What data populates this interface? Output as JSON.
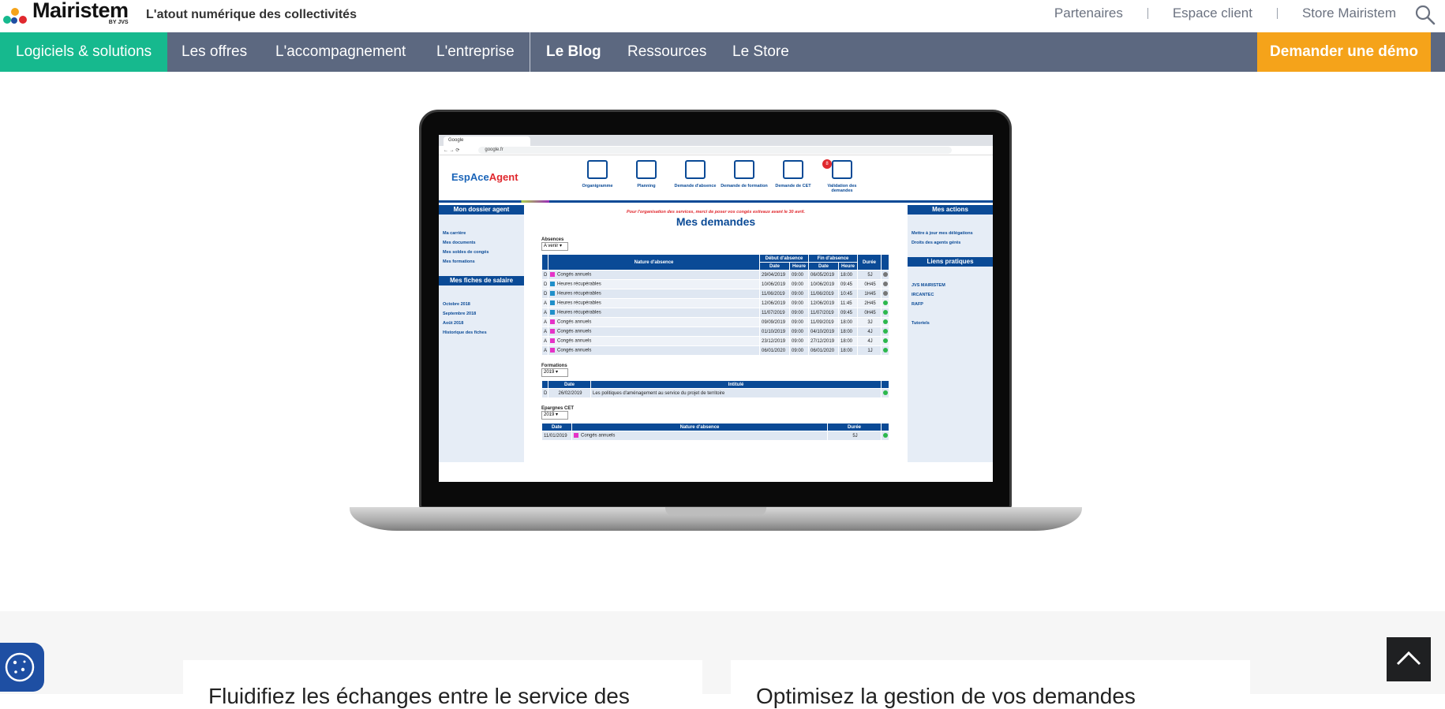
{
  "header": {
    "brand": "Mairistem",
    "brand_by": "BY JVS",
    "tagline": "L'atout numérique des collectivités",
    "links": [
      "Partenaires",
      "Espace client",
      "Store Mairistem"
    ]
  },
  "nav": {
    "items": [
      "Logiciels & solutions",
      "Les offres",
      "L'accompagnement",
      "L'entreprise",
      "Le Blog",
      "Ressources",
      "Le Store"
    ],
    "demo_label": "Demander une démo"
  },
  "screen": {
    "tab_title": "Google",
    "url": "google.fr",
    "logo_text": "EspAce",
    "logo_text2": "Agent",
    "nav": [
      "Organigramme",
      "Planning",
      "Demande d'absence",
      "Demande de formation",
      "Demande de CET",
      "Validation des demandes"
    ],
    "badge": "8",
    "left": {
      "head1": "Mon dossier agent",
      "links1": [
        "Ma carrière",
        "Mes documents",
        "Mes soldes de congés",
        "Mes formations"
      ],
      "head2": "Mes fiches de salaire",
      "links2": [
        "Octobre 2018",
        "Septembre 2018",
        "Août 2018",
        "Historique des fiches"
      ]
    },
    "right": {
      "head1": "Mes actions",
      "links1": [
        "Mettre à jour mes délégations",
        "Droits des agents gérés"
      ],
      "head2": "Liens pratiques",
      "links2": [
        "JVS MAIRISTEM",
        "IRCANTEC",
        "RAFP",
        "Tutoriels"
      ]
    },
    "notice": "Pour l'organisation des services, merci de poser vos congés estivaux avant le 30 avril.",
    "title": "Mes demandes",
    "absences": {
      "label": "Absences",
      "filter": "A venir",
      "headers": {
        "nature": "Nature d'absence",
        "debut": "Début d'absence",
        "fin": "Fin d'absence",
        "duree": "Durée",
        "date": "Date",
        "heure": "Heure"
      },
      "rows": [
        {
          "s": "D",
          "nature": "Congés annuels",
          "d1": "29/04/2019",
          "h1": "09:00",
          "d2": "06/05/2019",
          "h2": "18:00",
          "dur": "5J",
          "color": "#e533c7",
          "status": "grey"
        },
        {
          "s": "D",
          "nature": "Heures récupérables",
          "d1": "10/06/2019",
          "h1": "09:00",
          "d2": "10/06/2019",
          "h2": "09:45",
          "dur": "0H45",
          "color": "#1f8fc9",
          "status": "grey"
        },
        {
          "s": "D",
          "nature": "Heures récupérables",
          "d1": "11/06/2019",
          "h1": "09:00",
          "d2": "11/06/2019",
          "h2": "10:45",
          "dur": "1H45",
          "color": "#1f8fc9",
          "status": "grey"
        },
        {
          "s": "A",
          "nature": "Heures récupérables",
          "d1": "12/06/2019",
          "h1": "09:00",
          "d2": "12/06/2019",
          "h2": "11:45",
          "dur": "2H45",
          "color": "#1f8fc9",
          "status": "green"
        },
        {
          "s": "A",
          "nature": "Heures récupérables",
          "d1": "11/07/2019",
          "h1": "09:00",
          "d2": "11/07/2019",
          "h2": "09:45",
          "dur": "0H45",
          "color": "#1f8fc9",
          "status": "green"
        },
        {
          "s": "A",
          "nature": "Congés annuels",
          "d1": "09/09/2019",
          "h1": "09:00",
          "d2": "11/09/2019",
          "h2": "18:00",
          "dur": "3J",
          "color": "#e533c7",
          "status": "green"
        },
        {
          "s": "A",
          "nature": "Congés annuels",
          "d1": "01/10/2019",
          "h1": "09:00",
          "d2": "04/10/2019",
          "h2": "18:00",
          "dur": "4J",
          "color": "#e533c7",
          "status": "green"
        },
        {
          "s": "A",
          "nature": "Congés annuels",
          "d1": "23/12/2019",
          "h1": "09:00",
          "d2": "27/12/2019",
          "h2": "18:00",
          "dur": "4J",
          "color": "#e533c7",
          "status": "green"
        },
        {
          "s": "A",
          "nature": "Congés annuels",
          "d1": "06/01/2020",
          "h1": "09:00",
          "d2": "06/01/2020",
          "h2": "18:00",
          "dur": "1J",
          "color": "#e533c7",
          "status": "green"
        }
      ]
    },
    "formations": {
      "label": "Formations",
      "filter": "2019",
      "headers": {
        "date": "Date",
        "intitule": "Intitulé"
      },
      "rows": [
        {
          "s": "D",
          "date": "26/02/2019",
          "intitule": "Les politiques d'aménagement au service du projet de territoire",
          "status": "green"
        }
      ]
    },
    "cet": {
      "label": "Epargnes CET",
      "filter": "2019",
      "headers": {
        "date": "Date",
        "nature": "Nature d'absence",
        "duree": "Durée"
      },
      "rows": [
        {
          "date": "11/01/2019",
          "nature": "Congés annuels",
          "dur": "5J",
          "color": "#e533c7",
          "status": "green"
        }
      ]
    }
  },
  "cards": [
    {
      "text": "Fluidifiez les échanges entre le service des"
    },
    {
      "text": "Optimisez la gestion de vos demandes"
    }
  ],
  "colors": {
    "accent": "#16b98e",
    "nav": "#5c6880",
    "demo": "#f5a31a",
    "ea_blue": "#0a4a96"
  }
}
